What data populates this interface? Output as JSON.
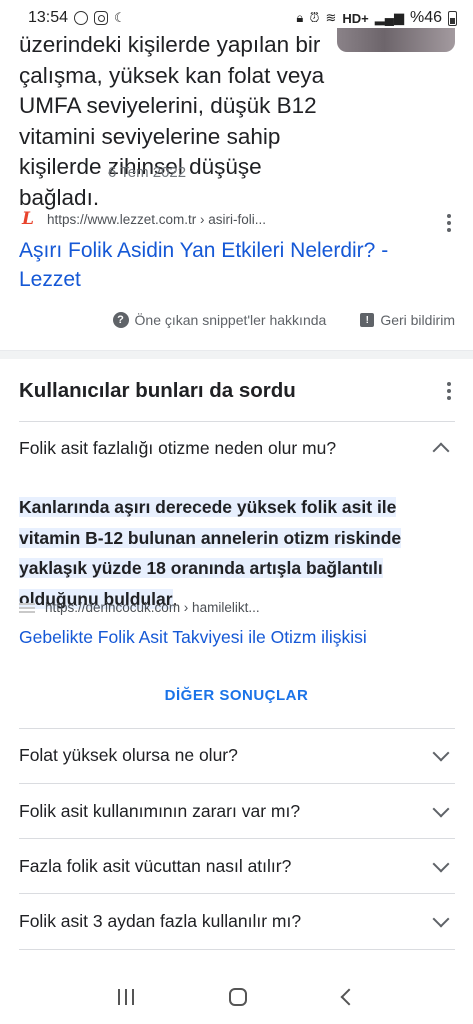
{
  "status_bar": {
    "time": "13:54",
    "network": "HD+",
    "battery": "%46"
  },
  "snippet": {
    "text": "üzerindeki kişilerde yapılan bir çalışma, yüksek kan folat veya UMFA seviyelerini, düşük B12 vitamini seviyelerine sahip kişilerde zihinsel düşüşe bağladı.",
    "date": "6 Tem 2022"
  },
  "result": {
    "url": "https://www.lezzet.com.tr › asiri-foli...",
    "title": "Aşırı Folik Asidin Yan Etkileri Nelerdir? - Lezzet"
  },
  "feedback": {
    "about_snippets": "Öne çıkan snippet'ler hakkında",
    "report": "Geri bildirim"
  },
  "paa": {
    "title": "Kullanıcılar bunları da sordu",
    "expanded_question": "Folik asit fazlalığı otizme neden olur mu?",
    "answer_highlight": "Kanlarında aşırı derecede yüksek folik asit ile vitamin B-12 bulunan annelerin otizm riskinde yaklaşık yüzde 18 oranında artışla bağlantılı olduğunu buldular",
    "answer_tail": ".",
    "answer_url": "https://derincocuk.com › hamilelikt...",
    "answer_link": "Gebelikte Folik Asit Takviyesi ile Otizm ilişkisi",
    "more_results": "DİĞER SONUÇLAR",
    "questions": [
      "Folat yüksek olursa ne olur?",
      "Folik asit kullanımının zararı var mı?",
      "Fazla folik asit vücuttan nasıl atılır?",
      "Folik asit 3 aydan fazla kullanılır mı?"
    ]
  }
}
